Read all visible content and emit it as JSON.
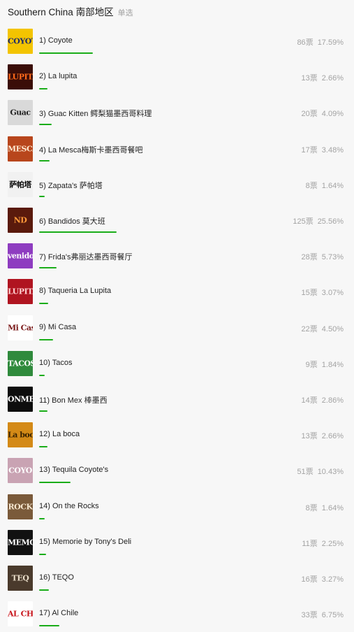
{
  "header": {
    "title": "Southern China 南部地区",
    "badge": "单选"
  },
  "vote_unit": "票",
  "items": [
    {
      "label": "1) Coyote",
      "votes": "86",
      "percent": "17.59%",
      "share": 0.1759,
      "icon": "coyote-logo-icon",
      "thumb_text": "COYOTE",
      "bg": "#f3c400",
      "fg": "#1e2b6b"
    },
    {
      "label": "2) La lupita",
      "votes": "13",
      "percent": "2.66%",
      "share": 0.0266,
      "icon": "la-lupita-sign-icon",
      "thumb_text": "LUPITA",
      "bg": "#3a0d08",
      "fg": "#ff6a1a"
    },
    {
      "label": "3) Guac Kitten 鳄梨猫墨西哥料理",
      "votes": "20",
      "percent": "4.09%",
      "share": 0.0409,
      "icon": "guac-kitten-logo-icon",
      "thumb_text": "Guac",
      "bg": "#d9d9d9",
      "fg": "#222222"
    },
    {
      "label": "4) La Mesca梅斯卡墨西哥餐吧",
      "votes": "17",
      "percent": "3.48%",
      "share": 0.0348,
      "icon": "la-mesca-sign-icon",
      "thumb_text": "MESCA",
      "bg": "#b8461c",
      "fg": "#ffe8cf"
    },
    {
      "label": "5) Zapata's 萨帕塔",
      "votes": "8",
      "percent": "1.64%",
      "share": 0.0164,
      "icon": "zapatas-logo-icon",
      "thumb_text": "萨帕塔",
      "bg": "#f1f1f1",
      "fg": "#111111"
    },
    {
      "label": "6) Bandidos 莫大班",
      "votes": "125",
      "percent": "25.56%",
      "share": 0.2556,
      "icon": "bandidos-sign-icon",
      "thumb_text": "ND",
      "bg": "#5a1a0c",
      "fg": "#ff9a3a"
    },
    {
      "label": "7) Frida's弗丽达墨西哥餐厅",
      "votes": "28",
      "percent": "5.73%",
      "share": 0.0573,
      "icon": "fridas-logo-icon",
      "thumb_text": "venidos",
      "bg": "#8e3cc0",
      "fg": "#ffffff"
    },
    {
      "label": "8) Taqueria La Lupita",
      "votes": "15",
      "percent": "3.07%",
      "share": 0.0307,
      "icon": "taqueria-la-lupita-sign-icon",
      "thumb_text": "LUPITA",
      "bg": "#b01420",
      "fg": "#ffd0d0"
    },
    {
      "label": "9) Mi Casa",
      "votes": "22",
      "percent": "4.50%",
      "share": 0.045,
      "icon": "mi-casa-logo-icon",
      "thumb_text": "Mi Casa",
      "bg": "#ffffff",
      "fg": "#7a1a1a"
    },
    {
      "label": "10) Tacos",
      "votes": "9",
      "percent": "1.84%",
      "share": 0.0184,
      "icon": "tacos-sign-icon",
      "thumb_text": "TACOS",
      "bg": "#2f8a3c",
      "fg": "#ffffff"
    },
    {
      "label": "11) Bon Mex 棒墨西",
      "votes": "14",
      "percent": "2.86%",
      "share": 0.0286,
      "icon": "bon-mex-logo-icon",
      "thumb_text": "ONME",
      "bg": "#0d0d0d",
      "fg": "#ffffff"
    },
    {
      "label": "12) La boca",
      "votes": "13",
      "percent": "2.66%",
      "share": 0.0266,
      "icon": "la-boca-logo-icon",
      "thumb_text": "La boca",
      "bg": "#d48a16",
      "fg": "#3a2300"
    },
    {
      "label": "13) Tequila Coyote's",
      "votes": "51",
      "percent": "10.43%",
      "share": 0.1043,
      "icon": "tequila-coyotes-sign-icon",
      "thumb_text": "COYO",
      "bg": "#c9a3b3",
      "fg": "#ffffff"
    },
    {
      "label": "14) On the Rocks",
      "votes": "8",
      "percent": "1.64%",
      "share": 0.0164,
      "icon": "on-the-rocks-sign-icon",
      "thumb_text": "ROCK",
      "bg": "#7a5a3a",
      "fg": "#f5e6cf"
    },
    {
      "label": "15) Memorie by Tony's Deli",
      "votes": "11",
      "percent": "2.25%",
      "share": 0.0225,
      "icon": "memorie-logo-icon",
      "thumb_text": "MEMOR",
      "bg": "#111111",
      "fg": "#ffffff"
    },
    {
      "label": "16) TEQO",
      "votes": "16",
      "percent": "3.27%",
      "share": 0.0327,
      "icon": "teqo-sign-icon",
      "thumb_text": "TEQ",
      "bg": "#4a3a2c",
      "fg": "#e8dcc8"
    },
    {
      "label": "17) Al Chile",
      "votes": "33",
      "percent": "6.75%",
      "share": 0.0675,
      "icon": "al-chile-logo-icon",
      "thumb_text": "AL CHILE",
      "bg": "#ffffff",
      "fg": "#c8161d"
    }
  ]
}
